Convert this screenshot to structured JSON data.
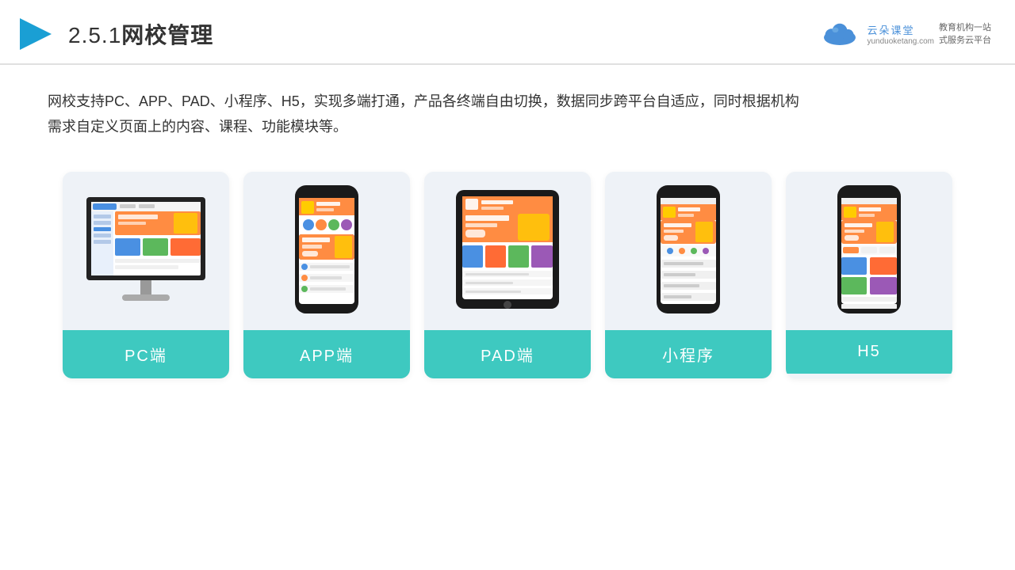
{
  "header": {
    "title": "2.5.1网校管理",
    "logo_name": "云朵课堂",
    "logo_url": "yunduoketang.com",
    "logo_tagline": "教育机构一站\n式服务云平台"
  },
  "description": {
    "text": "网校支持PC、APP、PAD、小程序、H5，实现多端打通，产品各终端自由切换，数据同步跨平台自适应，同时根据机构需求自定义页面上的内容、课程、功能模块等。"
  },
  "cards": [
    {
      "id": "pc",
      "label": "PC端"
    },
    {
      "id": "app",
      "label": "APP端"
    },
    {
      "id": "pad",
      "label": "PAD端"
    },
    {
      "id": "miniprogram",
      "label": "小程序"
    },
    {
      "id": "h5",
      "label": "H5"
    }
  ],
  "colors": {
    "teal": "#3ec9c0",
    "accent_orange": "#ff8c42",
    "accent_blue": "#4a90e2"
  }
}
